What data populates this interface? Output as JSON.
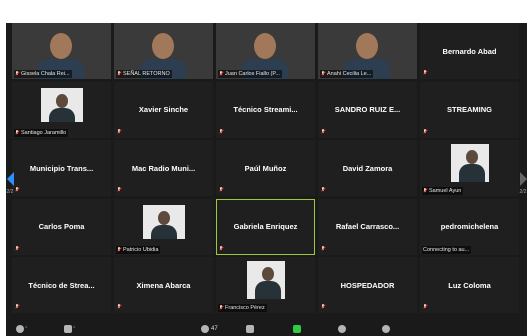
{
  "participants": [
    {
      "name": "Gissela Chala Rei...",
      "type": "video",
      "bg": "v1"
    },
    {
      "name": "SEÑAL RETORNO",
      "type": "video",
      "bg": "v2"
    },
    {
      "name": "Juan Carlos Fiallo (P...",
      "type": "video",
      "bg": "v3"
    },
    {
      "name": "Anahi Cecilia Le...",
      "type": "video",
      "bg": "v4"
    },
    {
      "name": "Bernardo Abad",
      "type": "name"
    },
    {
      "name": "Santiago Jaramillo",
      "type": "photo"
    },
    {
      "name": "Xavier Sinche",
      "type": "name"
    },
    {
      "name": "Técnico Streami...",
      "type": "name"
    },
    {
      "name": "SANDRO RUIZ E...",
      "type": "name"
    },
    {
      "name": "STREAMING",
      "type": "name"
    },
    {
      "name": "Municipio Trans...",
      "type": "name"
    },
    {
      "name": "Mac Radio Muni...",
      "type": "name"
    },
    {
      "name": "Paúl Muñoz",
      "type": "name"
    },
    {
      "name": "David Zamora",
      "type": "name"
    },
    {
      "name": "Samuel Ayun",
      "type": "photo"
    },
    {
      "name": "Carlos Poma",
      "type": "name"
    },
    {
      "name": "Patricio Ubidia",
      "type": "photo"
    },
    {
      "name": "Gabriela Enriquez",
      "type": "name",
      "highlight": true
    },
    {
      "name": "Rafael Carrasco...",
      "type": "name"
    },
    {
      "name": "pedromichelena",
      "type": "name",
      "status": "Connecting to au..."
    },
    {
      "name": "Técnico de Strea...",
      "type": "name"
    },
    {
      "name": "Ximena Abarca",
      "type": "name"
    },
    {
      "name": "Francisco Pérez",
      "type": "photo"
    },
    {
      "name": "HOSPEDADOR",
      "type": "name"
    },
    {
      "name": "Luz Coloma",
      "type": "name"
    }
  ],
  "pager": {
    "left": "2/2",
    "right": "2/2"
  },
  "toolbar": {
    "participants_count": "47"
  },
  "colors": {
    "muted": "#ff3b30",
    "active_speaker": "#9cc93a",
    "nav_arrow": "#2f8fff"
  }
}
